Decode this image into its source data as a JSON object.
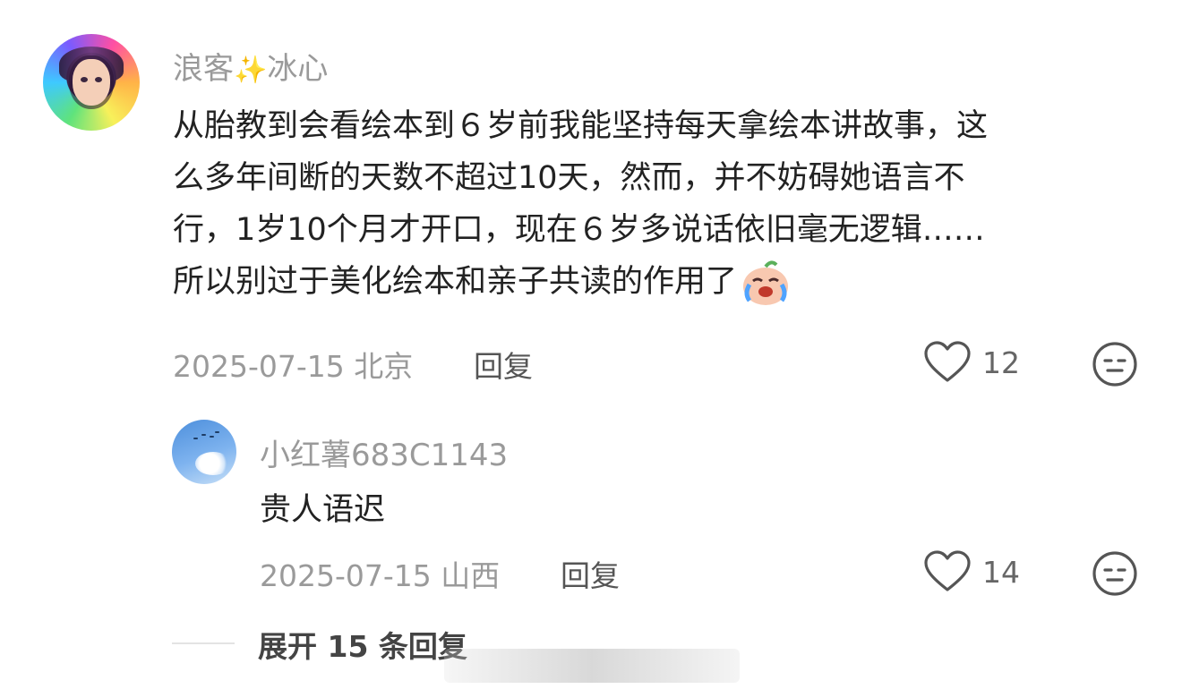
{
  "comment": {
    "username": "浪客",
    "username_suffix": "冰心",
    "sparkle_icon": "sparkles-icon",
    "lines": [
      "从胎教到会看绘本到６岁前我能坚持每天拿绘本讲故事，这",
      "么多年间断的天数不超过10天，然而，并不妨碍她语言不",
      "行，1岁10个月才开口，现在６岁多说话依旧毫无逻辑……",
      "所以别过于美化绘本和亲子共读的作用了"
    ],
    "emoji": "crying-face-emoji",
    "date": "2025-07-15",
    "location": "北京",
    "reply_label": "回复",
    "likes": "12"
  },
  "reply": {
    "username": "小红薯683C1143",
    "text": "贵人语迟",
    "date": "2025-07-15",
    "location": "山西",
    "reply_label": "回复",
    "likes": "14"
  },
  "expand_label": "展开 15 条回复",
  "colors": {
    "username": "#9a9a9a",
    "body": "#222222",
    "meta": "#9a9a9a"
  }
}
